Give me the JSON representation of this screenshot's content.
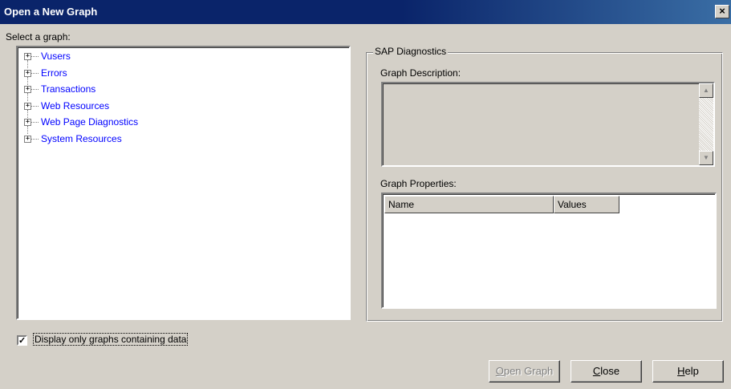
{
  "window": {
    "title": "Open a New Graph",
    "close_glyph": "×"
  },
  "tree": {
    "label": "Select a graph:",
    "items": [
      {
        "label": "Vusers"
      },
      {
        "label": "Errors"
      },
      {
        "label": "Transactions"
      },
      {
        "label": "Web Resources"
      },
      {
        "label": "Web Page Diagnostics"
      },
      {
        "label": "System Resources"
      }
    ],
    "expander_glyph": "+"
  },
  "details": {
    "group_title": "SAP Diagnostics",
    "description_label": "Graph Description:",
    "description_text": "",
    "properties_label": "Graph Properties:",
    "columns": [
      "Name",
      "Values"
    ],
    "scroll_up_glyph": "▲",
    "scroll_down_glyph": "▼"
  },
  "filter": {
    "label": "Display only graphs containing data",
    "checked": true,
    "check_glyph": "✓"
  },
  "buttons": {
    "open_mnemonic": "O",
    "open_rest": "pen Graph",
    "close_mnemonic": "C",
    "close_rest": "lose",
    "help_mnemonic": "H",
    "help_rest": "elp"
  }
}
